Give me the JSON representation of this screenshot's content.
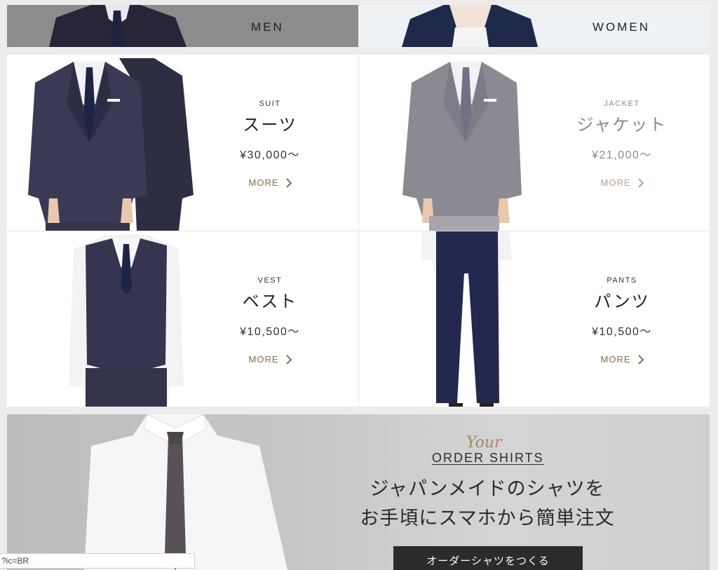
{
  "gender_tabs": [
    {
      "label": "MEN"
    },
    {
      "label": "WOMEN"
    }
  ],
  "products": [
    {
      "en": "SUIT",
      "ja": "スーツ",
      "price": "¥30,000〜",
      "more": "MORE"
    },
    {
      "en": "JACKET",
      "ja": "ジャケット",
      "price": "¥21,000〜",
      "more": "MORE"
    },
    {
      "en": "VEST",
      "ja": "ベスト",
      "price": "¥10,500〜",
      "more": "MORE"
    },
    {
      "en": "PANTS",
      "ja": "パンツ",
      "price": "¥10,500〜",
      "more": "MORE"
    }
  ],
  "banner": {
    "script": "Your",
    "kicker": "ORDER SHIRTS",
    "headline_line1": "ジャパンメイドのシャツを",
    "headline_line2": "お手頃にスマホから簡単注文",
    "cta": "オーダーシャツをつくる"
  },
  "statusbar": {
    "url": "?ic=BR"
  },
  "colors": {
    "suit_navy": "#3a3a55",
    "jacket_grey": "#8b8a93",
    "accent_brown": "#8a6a4a",
    "cta_bg": "#2b2b2b"
  }
}
